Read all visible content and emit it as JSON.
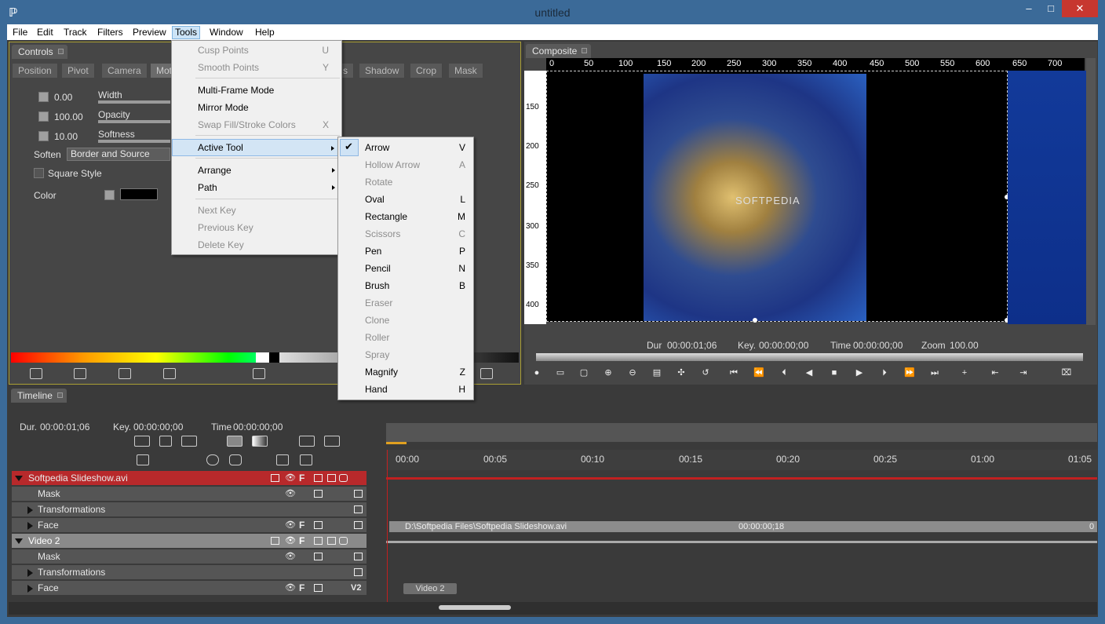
{
  "window": {
    "title": "untitled",
    "min_icon": "minimize-icon",
    "max_icon": "maximize-icon",
    "close_icon": "close-icon"
  },
  "menubar": [
    "File",
    "Edit",
    "Track",
    "Filters",
    "Preview",
    "Tools",
    "Window",
    "Help"
  ],
  "controls": {
    "tab": "Controls",
    "subtabs": [
      "Position",
      "Pivot",
      "Camera",
      "Moti",
      "s",
      "Shadow",
      "Crop",
      "Mask"
    ],
    "rows": [
      {
        "value": "0.00",
        "label": "Width"
      },
      {
        "value": "100.00",
        "label": "Opacity"
      },
      {
        "value": "10.00",
        "label": "Softness"
      }
    ],
    "soften_label": "Soften",
    "soften_value": "Border and Source",
    "square_style": "Square Style",
    "color_label": "Color"
  },
  "composite": {
    "tab": "Composite",
    "ruler_top": [
      "0",
      "50",
      "100",
      "150",
      "200",
      "250",
      "300",
      "350",
      "400",
      "450",
      "500",
      "550",
      "600",
      "650",
      "700"
    ],
    "ruler_left": [
      "150",
      "200",
      "250",
      "300",
      "350",
      "400"
    ],
    "watermark": "SOFTPEDIA",
    "dur_label": "Dur",
    "dur": "00:00:01;06",
    "key_label": "Key.",
    "key": "00:00:00;00",
    "time_label": "Time",
    "time": "00:00:00;00",
    "zoom_label": "Zoom",
    "zoom": "100.00"
  },
  "timeline": {
    "tab": "Timeline",
    "dur_label": "Dur.",
    "dur": "00:00:01;06",
    "key_label": "Key.",
    "key": "00:00:00;00",
    "time_label": "Time",
    "time": "00:00:00;00",
    "ticks": [
      "00:00",
      "00:05",
      "00:10",
      "00:15",
      "00:20",
      "00:25",
      "01:00",
      "01:05"
    ],
    "tracks": [
      {
        "name": "Softpedia Slideshow.avi",
        "type": "main-red"
      },
      {
        "name": "Mask",
        "type": "sub"
      },
      {
        "name": "Transformations",
        "type": "sub-exp"
      },
      {
        "name": "Face",
        "type": "sub-exp"
      },
      {
        "name": "Video 2",
        "type": "main-gray"
      },
      {
        "name": "Mask",
        "type": "sub"
      },
      {
        "name": "Transformations",
        "type": "sub-exp"
      },
      {
        "name": "Face",
        "type": "sub-exp"
      }
    ],
    "clip_path": "D:\\Softpedia Files\\Softpedia Slideshow.avi",
    "clip_time": "00:00:00;18",
    "clip_end": "0",
    "video2_clip": "Video 2",
    "v2_badge": "V2"
  },
  "tools_menu": [
    {
      "label": "Cusp Points",
      "shortcut": "U",
      "disabled": true
    },
    {
      "label": "Smooth Points",
      "shortcut": "Y",
      "disabled": true
    },
    {
      "sep": true
    },
    {
      "label": "Multi-Frame Mode",
      "shortcut": "",
      "disabled": false
    },
    {
      "label": "Mirror Mode",
      "shortcut": "",
      "disabled": false
    },
    {
      "label": "Swap Fill/Stroke Colors",
      "shortcut": "X",
      "disabled": true
    },
    {
      "sep": true
    },
    {
      "label": "Active Tool",
      "shortcut": "",
      "disabled": false,
      "submenu": true,
      "highlight": true
    },
    {
      "sep": true
    },
    {
      "label": "Arrange",
      "shortcut": "",
      "disabled": false,
      "submenu": true
    },
    {
      "label": "Path",
      "shortcut": "",
      "disabled": false,
      "submenu": true
    },
    {
      "sep": true
    },
    {
      "label": "Next Key",
      "shortcut": "",
      "disabled": true
    },
    {
      "label": "Previous Key",
      "shortcut": "",
      "disabled": true
    },
    {
      "label": "Delete Key",
      "shortcut": "",
      "disabled": true
    }
  ],
  "active_tool_menu": [
    {
      "label": "Arrow",
      "shortcut": "V",
      "disabled": false,
      "checked": true
    },
    {
      "label": "Hollow Arrow",
      "shortcut": "A",
      "disabled": true
    },
    {
      "label": "Rotate",
      "shortcut": "",
      "disabled": true
    },
    {
      "label": "Oval",
      "shortcut": "L",
      "disabled": false
    },
    {
      "label": "Rectangle",
      "shortcut": "M",
      "disabled": false
    },
    {
      "label": "Scissors",
      "shortcut": "C",
      "disabled": true
    },
    {
      "label": "Pen",
      "shortcut": "P",
      "disabled": false
    },
    {
      "label": "Pencil",
      "shortcut": "N",
      "disabled": false
    },
    {
      "label": "Brush",
      "shortcut": "B",
      "disabled": false
    },
    {
      "label": "Eraser",
      "shortcut": "",
      "disabled": true
    },
    {
      "label": "Clone",
      "shortcut": "",
      "disabled": true
    },
    {
      "label": "Roller",
      "shortcut": "",
      "disabled": true
    },
    {
      "label": "Spray",
      "shortcut": "",
      "disabled": true
    },
    {
      "label": "Magnify",
      "shortcut": "Z",
      "disabled": false
    },
    {
      "label": "Hand",
      "shortcut": "H",
      "disabled": false
    }
  ]
}
